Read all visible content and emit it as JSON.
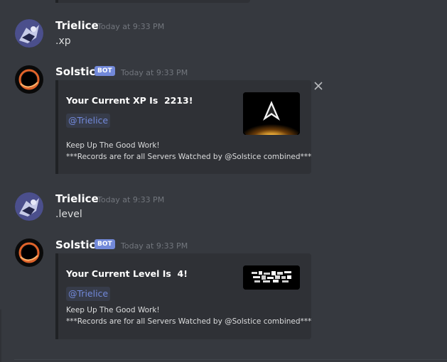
{
  "messages": [
    {
      "username": "Trielice",
      "timestamp": "Today at 9:33 PM",
      "content": ".xp"
    },
    {
      "username": "Solstice",
      "bot_tag": "BOT",
      "timestamp": "Today at 9:33 PM",
      "embed": {
        "title": "Your Current XP Is  2213!",
        "mention": "@Trielice",
        "line1": "Keep Up The Good Work!",
        "line2": "***Records are for all Servers Watched by @Solstice combined***",
        "thumbnail_icon": "rank-chevron-image"
      }
    },
    {
      "username": "Trielice",
      "timestamp": "Today at 9:33 PM",
      "content": ".level"
    },
    {
      "username": "Solstice",
      "bot_tag": "BOT",
      "timestamp": "Today at 9:33 PM",
      "embed": {
        "title": "Your Current Level Is  4!",
        "mention": "@Trielice",
        "line1": "Keep Up The Good Work!",
        "line2": "***Records are for all Servers Watched by @Solstice combined***",
        "thumbnail_icon": "level-banner-image"
      }
    }
  ],
  "colors": {
    "background": "#36393f",
    "embed_background": "#2f3136",
    "embed_border": "#202225",
    "bot_tag": "#7289da",
    "mention": "#7289da",
    "timestamp": "#72767d"
  },
  "icons": {
    "close": "close-icon"
  }
}
